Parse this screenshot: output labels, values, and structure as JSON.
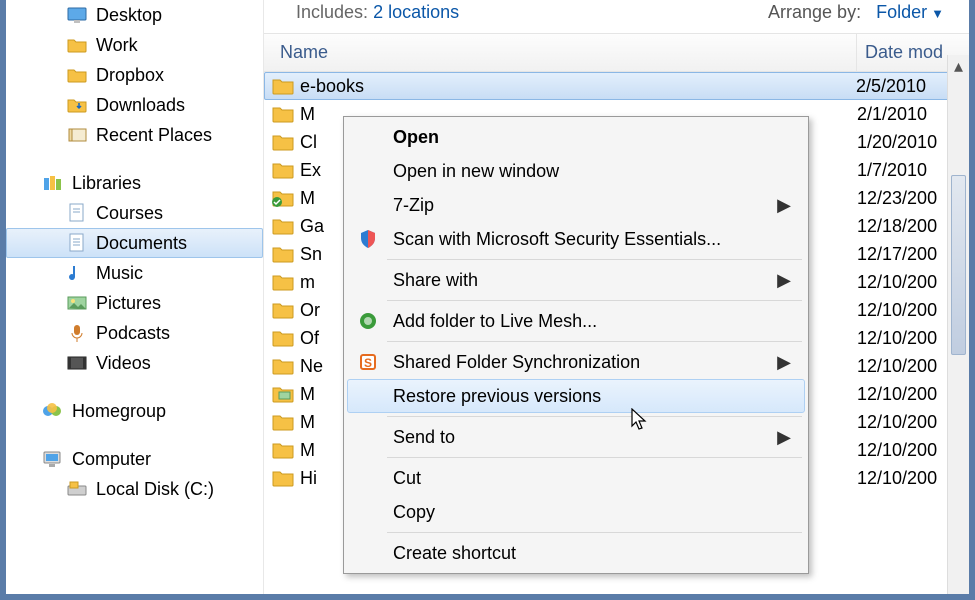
{
  "header": {
    "includes_label": "Includes:",
    "includes_link": "2 locations",
    "arrange_label": "Arrange by:",
    "arrange_value": "Folder"
  },
  "sidebar": {
    "favorites": [
      {
        "label": "Desktop",
        "icon": "desktop-icon"
      },
      {
        "label": "Work",
        "icon": "folder-icon"
      },
      {
        "label": "Dropbox",
        "icon": "folder-icon"
      },
      {
        "label": "Downloads",
        "icon": "downloads-icon"
      },
      {
        "label": "Recent Places",
        "icon": "recent-icon"
      }
    ],
    "libraries_label": "Libraries",
    "libraries": [
      {
        "label": "Courses",
        "icon": "document-icon"
      },
      {
        "label": "Documents",
        "icon": "document-icon",
        "selected": true
      },
      {
        "label": "Music",
        "icon": "music-icon"
      },
      {
        "label": "Pictures",
        "icon": "pictures-icon"
      },
      {
        "label": "Podcasts",
        "icon": "podcasts-icon"
      },
      {
        "label": "Videos",
        "icon": "videos-icon"
      }
    ],
    "homegroup_label": "Homegroup",
    "computer_label": "Computer",
    "computer_items": [
      {
        "label": "Local Disk (C:)",
        "icon": "disk-icon"
      }
    ]
  },
  "columns": {
    "name": "Name",
    "date": "Date mod"
  },
  "files": [
    {
      "name": "e-books",
      "date": "2/5/2010",
      "icon": "folder-icon",
      "selected": true
    },
    {
      "name": "M",
      "date": "2/1/2010",
      "icon": "folder-icon"
    },
    {
      "name": "Cl",
      "date": "1/20/2010",
      "icon": "folder-icon"
    },
    {
      "name": "Ex",
      "date": "1/7/2010",
      "icon": "folder-icon"
    },
    {
      "name": "M",
      "date": "12/23/200",
      "icon": "folder-check-icon"
    },
    {
      "name": "Ga",
      "date": "12/18/200",
      "icon": "folder-icon"
    },
    {
      "name": "Sn",
      "date": "12/17/200",
      "icon": "folder-icon"
    },
    {
      "name": "m",
      "date": "12/10/200",
      "icon": "folder-icon"
    },
    {
      "name": "Or",
      "date": "12/10/200",
      "icon": "folder-icon"
    },
    {
      "name": "Of",
      "date": "12/10/200",
      "icon": "folder-icon"
    },
    {
      "name": "Ne",
      "date": "12/10/200",
      "icon": "folder-icon"
    },
    {
      "name": "M",
      "date": "12/10/200",
      "icon": "folder-pictures-icon"
    },
    {
      "name": "M",
      "date": "12/10/200",
      "icon": "folder-icon"
    },
    {
      "name": "M",
      "date": "12/10/200",
      "icon": "folder-icon"
    },
    {
      "name": "Hi",
      "date": "12/10/200",
      "icon": "folder-icon"
    }
  ],
  "context_menu": [
    {
      "label": "Open",
      "bold": true
    },
    {
      "label": "Open in new window"
    },
    {
      "label": "7-Zip",
      "submenu": true
    },
    {
      "label": "Scan with Microsoft Security Essentials...",
      "icon": "shield-icon"
    },
    {
      "sep": true
    },
    {
      "label": "Share with",
      "submenu": true
    },
    {
      "sep": true
    },
    {
      "label": "Add folder to Live Mesh...",
      "icon": "mesh-icon"
    },
    {
      "sep": true
    },
    {
      "label": "Shared Folder Synchronization",
      "icon": "sync-icon",
      "submenu": true
    },
    {
      "label": "Restore previous versions",
      "hover": true
    },
    {
      "sep": true
    },
    {
      "label": "Send to",
      "submenu": true
    },
    {
      "sep": true
    },
    {
      "label": "Cut"
    },
    {
      "label": "Copy"
    },
    {
      "sep": true
    },
    {
      "label": "Create shortcut"
    }
  ]
}
